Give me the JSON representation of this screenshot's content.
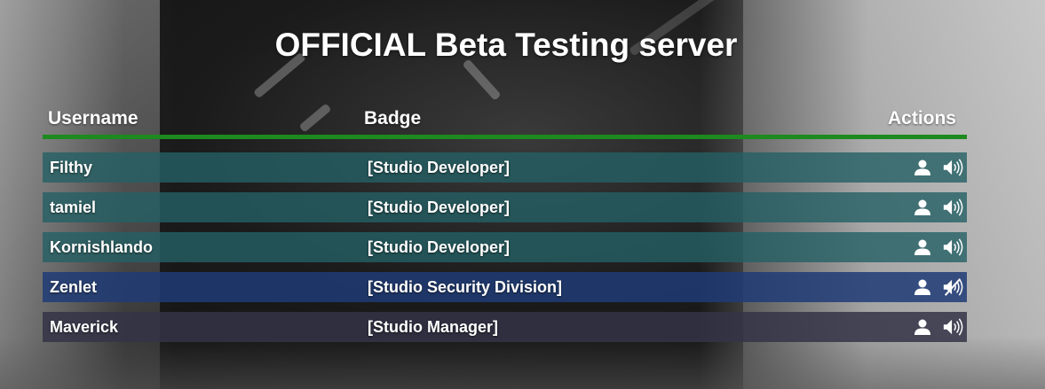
{
  "title": "OFFICIAL Beta Testing server",
  "header": {
    "username": "Username",
    "badge": "Badge",
    "actions": "Actions"
  },
  "colors": {
    "divider": "#1d8a1f",
    "row_developer": "#2a5f63",
    "row_security": "#243f73",
    "row_manager": "#3a3c52"
  },
  "players": [
    {
      "username": "Filthy",
      "badge": "[Studio Developer]",
      "row_color": "rgba(36,96,100,0.80)",
      "muted": false,
      "actions": [
        "profile-icon",
        "speaker-icon"
      ]
    },
    {
      "username": "tamiel",
      "badge": "[Studio Developer]",
      "row_color": "rgba(36,96,100,0.80)",
      "muted": false,
      "actions": [
        "profile-icon",
        "speaker-icon"
      ]
    },
    {
      "username": "Kornishlando",
      "badge": "[Studio Developer]",
      "row_color": "rgba(36,96,100,0.80)",
      "muted": false,
      "actions": [
        "profile-icon",
        "speaker-icon"
      ]
    },
    {
      "username": "Zenlet",
      "badge": "[Studio Security Division]",
      "row_color": "rgba(32,60,118,0.85)",
      "muted": true,
      "actions": [
        "profile-icon",
        "speaker-muted-icon"
      ]
    },
    {
      "username": "Maverick",
      "badge": "[Studio Manager]",
      "row_color": "rgba(52,52,72,0.85)",
      "muted": false,
      "actions": [
        "profile-icon",
        "speaker-icon"
      ]
    }
  ]
}
